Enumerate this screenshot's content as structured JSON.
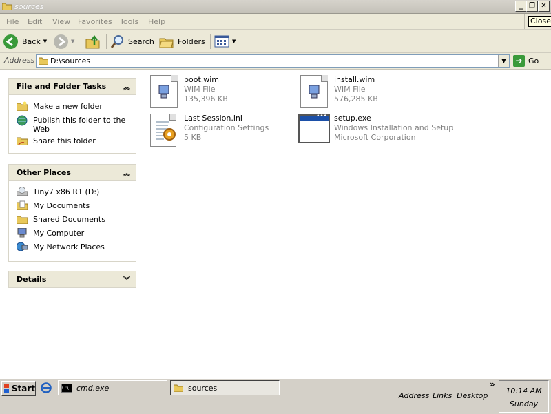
{
  "window": {
    "title": "sources",
    "min_label": "_",
    "restore_label": "❐",
    "close_label": "✕",
    "tooltip": "Close"
  },
  "menu": [
    "File",
    "Edit",
    "View",
    "Favorites",
    "Tools",
    "Help"
  ],
  "toolbar": {
    "back": "Back",
    "search": "Search",
    "folders": "Folders"
  },
  "address": {
    "label": "Address",
    "value": "D:\\sources",
    "go": "Go"
  },
  "tasks": {
    "title": "File and Folder Tasks",
    "items": [
      "Make a new folder",
      "Publish this folder to the Web",
      "Share this folder"
    ]
  },
  "other_places": {
    "title": "Other Places",
    "items": [
      "Tiny7 x86 R1 (D:)",
      "My Documents",
      "Shared Documents",
      "My Computer",
      "My Network Places"
    ]
  },
  "details": {
    "title": "Details"
  },
  "files": [
    {
      "name": "boot.wim",
      "line1": "WIM File",
      "line2": "135,396 KB",
      "icon": "wim-file-icon"
    },
    {
      "name": "install.wim",
      "line1": "WIM File",
      "line2": "576,285 KB",
      "icon": "wim-file-icon"
    },
    {
      "name": "Last Session.ini",
      "line1": "Configuration Settings",
      "line2": "5 KB",
      "icon": "ini-file-icon"
    },
    {
      "name": "setup.exe",
      "line1": "Windows Installation and Setup",
      "line2": "Microsoft Corporation",
      "icon": "exe-window-icon"
    }
  ],
  "taskbar": {
    "start": "Start",
    "tasks": [
      "cmd.exe",
      "sources"
    ],
    "toolbars": [
      "Address",
      "Links",
      "Desktop"
    ],
    "chevron": "»",
    "time": "10:14 AM",
    "day": "Sunday"
  },
  "colors": {
    "accent_blue": "#1c50a8",
    "go_green": "#3a9a3a",
    "panel_bg": "#ece9d8"
  }
}
